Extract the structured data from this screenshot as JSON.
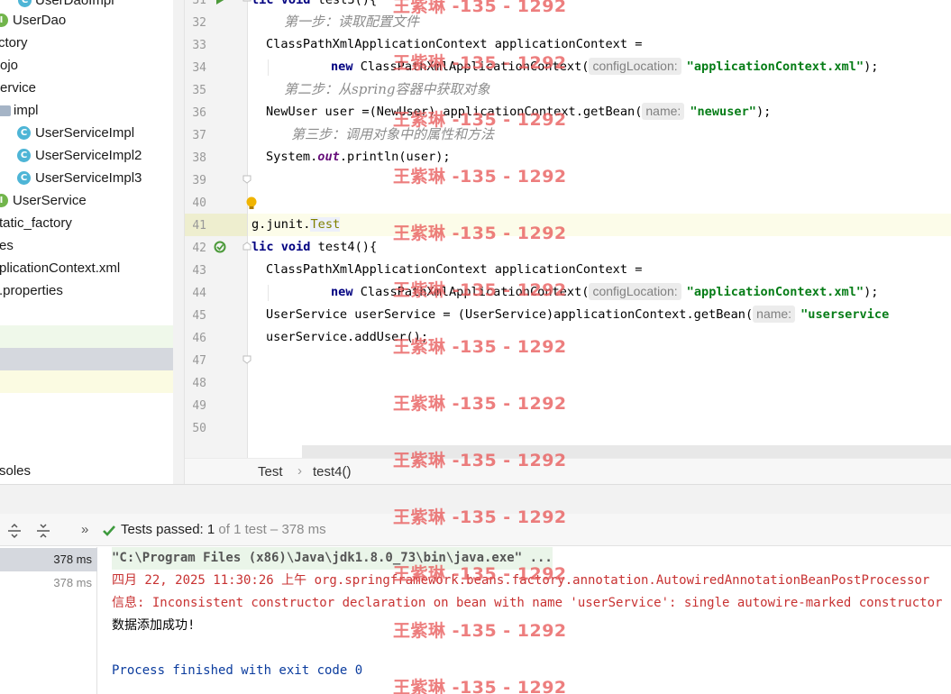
{
  "project_tree": {
    "items": [
      {
        "label": "UserDaoImpl",
        "icon": "class-icon"
      },
      {
        "label": "UserDao",
        "icon": "interface-icon"
      },
      {
        "label": "ctory",
        "icon": "none"
      },
      {
        "label": "ojo",
        "icon": "none"
      },
      {
        "label": "ervice",
        "icon": "none"
      },
      {
        "label": "impl",
        "icon": "folder-icon"
      },
      {
        "label": "UserServiceImpl",
        "icon": "class-icon"
      },
      {
        "label": "UserServiceImpl2",
        "icon": "class-icon"
      },
      {
        "label": "UserServiceImpl3",
        "icon": "class-icon"
      },
      {
        "label": "UserService",
        "icon": "interface-icon"
      },
      {
        "label": "tatic_factory",
        "icon": "none"
      },
      {
        "label": "es",
        "icon": "none"
      },
      {
        "label": "plicationContext.xml",
        "icon": "none"
      },
      {
        "label": ".properties",
        "icon": "none"
      }
    ],
    "consoles_label": "soles"
  },
  "editor": {
    "line_numbers": [
      "31",
      "32",
      "33",
      "34",
      "35",
      "36",
      "37",
      "38",
      "39",
      "40",
      "41",
      "42",
      "43",
      "44",
      "45",
      "46",
      "47",
      "48",
      "49",
      "50"
    ],
    "lines": {
      "l31": {
        "kw1": "lic void ",
        "rest": "test3(){"
      },
      "l32": {
        "comment": "第一步：读取配置文件"
      },
      "l33": {
        "text": "ClassPathXmlApplicationContext applicationContext ="
      },
      "l34": {
        "kw": "new ",
        "text": "ClassPathXmlApplicationContext(",
        "hint": "configLocation:",
        "str": "\"applicationContext.xml\"",
        "end": ");"
      },
      "l35": {
        "comment": "第二步：从spring容器中获取对象"
      },
      "l36": {
        "text": "NewUser user =(NewUser) applicationContext.getBean(",
        "hint": "name:",
        "str": "\"newuser\"",
        "end": ");"
      },
      "l37": {
        "comment": "第三步：调用对象中的属性和方法"
      },
      "l38": {
        "text_a": "System.",
        "field": "out",
        "text_b": ".println(user);"
      },
      "l41": {
        "prefix": "g.junit.",
        "highlight": "Test"
      },
      "l42": {
        "kw1": "lic void ",
        "rest": "test4(){"
      },
      "l43": {
        "text": "ClassPathXmlApplicationContext applicationContext ="
      },
      "l44": {
        "kw": "new ",
        "text": "ClassPathXmlApplicationContext(",
        "hint": "configLocation:",
        "str": "\"applicationContext.xml\"",
        "end": ");"
      },
      "l45": {
        "text": "UserService userService = (UserService)applicationContext.getBean(",
        "hint": "name:",
        "str": "\"userservice"
      },
      "l46": {
        "text": "userService.addUser();"
      }
    },
    "breadcrumb": [
      "Test",
      "test4()"
    ]
  },
  "run_panel": {
    "chevron": "»",
    "status_bold": "Tests passed: ",
    "count": "1",
    "detail": " of 1 test – 378 ms",
    "test_times": [
      "378 ms",
      "378 ms"
    ],
    "console": {
      "cmd": "\"C:\\Program Files (x86)\\Java\\jdk1.8.0_73\\bin\\java.exe\" ...",
      "log1": "四月 22, 2025 11:30:26 上午 org.springframework.beans.factory.annotation.AutowiredAnnotationBeanPostProcessor",
      "log2": "信息: Inconsistent constructor declaration on bean with name 'userService': single autowire-marked constructor",
      "output": "数据添加成功!",
      "exit": "Process finished with exit code 0"
    }
  },
  "watermark": "王紫琳 -135 - 1292",
  "colors": {
    "keyword": "#000080",
    "string": "#067d17",
    "comment": "#8c8c8c",
    "watermark": "#e85a5a",
    "pass_check": "#3d9a3d"
  }
}
